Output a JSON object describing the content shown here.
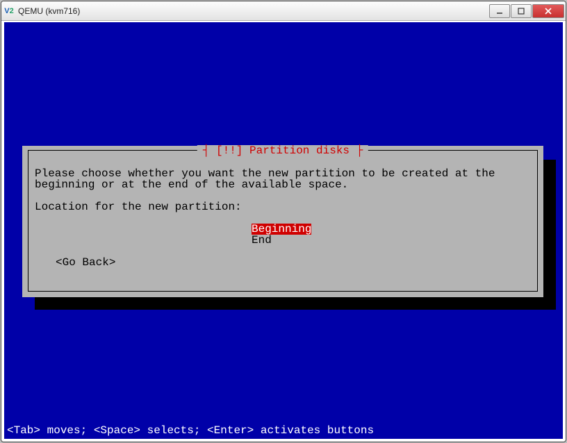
{
  "window": {
    "title": "QEMU (kvm716)",
    "icon_label": "V2"
  },
  "dialog": {
    "title": "[!!] Partition disks",
    "prompt": "Please choose whether you want the new partition to be created at the beginning or at the end of the available space.",
    "question": "Location for the new partition:",
    "options": [
      {
        "label": "Beginning",
        "selected": true
      },
      {
        "label": "End",
        "selected": false
      }
    ],
    "back_label": "<Go Back>"
  },
  "footer": {
    "hints": "<Tab> moves; <Space> selects; <Enter> activates buttons"
  }
}
